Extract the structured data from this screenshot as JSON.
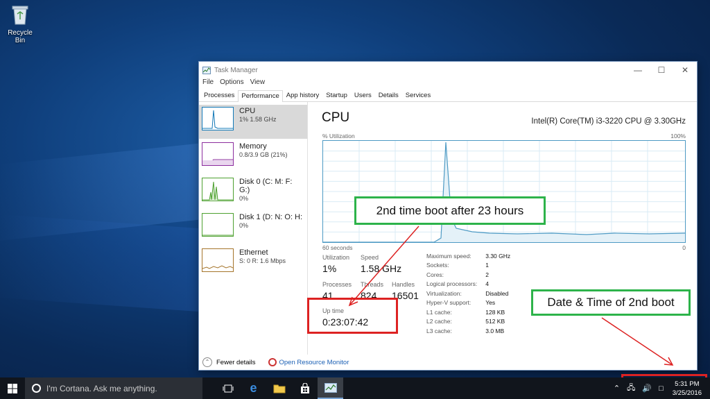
{
  "desktop": {
    "icon_label": "Recycle Bin"
  },
  "window": {
    "title": "Task Manager",
    "menu": [
      "File",
      "Options",
      "View"
    ],
    "tabs": [
      "Processes",
      "Performance",
      "App history",
      "Startup",
      "Users",
      "Details",
      "Services"
    ],
    "active_tab": "Performance"
  },
  "sidebar": {
    "items": [
      {
        "name": "CPU",
        "sub": "1% 1.58 GHz",
        "color": "#1278b7"
      },
      {
        "name": "Memory",
        "sub": "0.8/3.9 GB (21%)",
        "color": "#8b2c9e"
      },
      {
        "name": "Disk 0 (C: M: F: G:)",
        "sub": "0%",
        "color": "#4da02f"
      },
      {
        "name": "Disk 1 (D: N: O: H:",
        "sub": "0%",
        "color": "#4da02f"
      },
      {
        "name": "Ethernet",
        "sub": "S: 0 R: 1.6 Mbps",
        "color": "#a5742a"
      }
    ]
  },
  "cpu": {
    "title": "CPU",
    "model": "Intel(R) Core(TM) i3-3220 CPU @ 3.30GHz",
    "util_label": "% Utilization",
    "util_max": "100%",
    "graph_left": "60 seconds",
    "graph_right": "0",
    "stats": {
      "utilization_label": "Utilization",
      "utilization": "1%",
      "speed_label": "Speed",
      "speed": "1.58 GHz",
      "processes_label": "Processes",
      "processes": "41",
      "threads_label": "Threads",
      "threads": "824",
      "handles_label": "Handles",
      "handles": "16501",
      "uptime_label": "Up time",
      "uptime": "0:23:07:42"
    },
    "props": [
      {
        "k": "Maximum speed:",
        "v": "3.30 GHz"
      },
      {
        "k": "Sockets:",
        "v": "1"
      },
      {
        "k": "Cores:",
        "v": "2"
      },
      {
        "k": "Logical processors:",
        "v": "4"
      },
      {
        "k": "Virtualization:",
        "v": "Disabled"
      },
      {
        "k": "Hyper-V support:",
        "v": "Yes"
      },
      {
        "k": "L1 cache:",
        "v": "128 KB"
      },
      {
        "k": "L2 cache:",
        "v": "512 KB"
      },
      {
        "k": "L3 cache:",
        "v": "3.0 MB"
      }
    ]
  },
  "footer": {
    "fewer_details": "Fewer details",
    "open_monitor": "Open Resource Monitor"
  },
  "annotations": {
    "boot_note": "2nd time boot after 23 hours",
    "datetime_note": "Date & Time of 2nd boot"
  },
  "taskbar": {
    "search_placeholder": "I'm Cortana. Ask me anything.",
    "time": "5:31 PM",
    "date": "3/25/2016"
  },
  "colors": {
    "graph_line": "#4d9ac4",
    "annotation_green": "#2db34a",
    "annotation_red": "#dd2222"
  }
}
